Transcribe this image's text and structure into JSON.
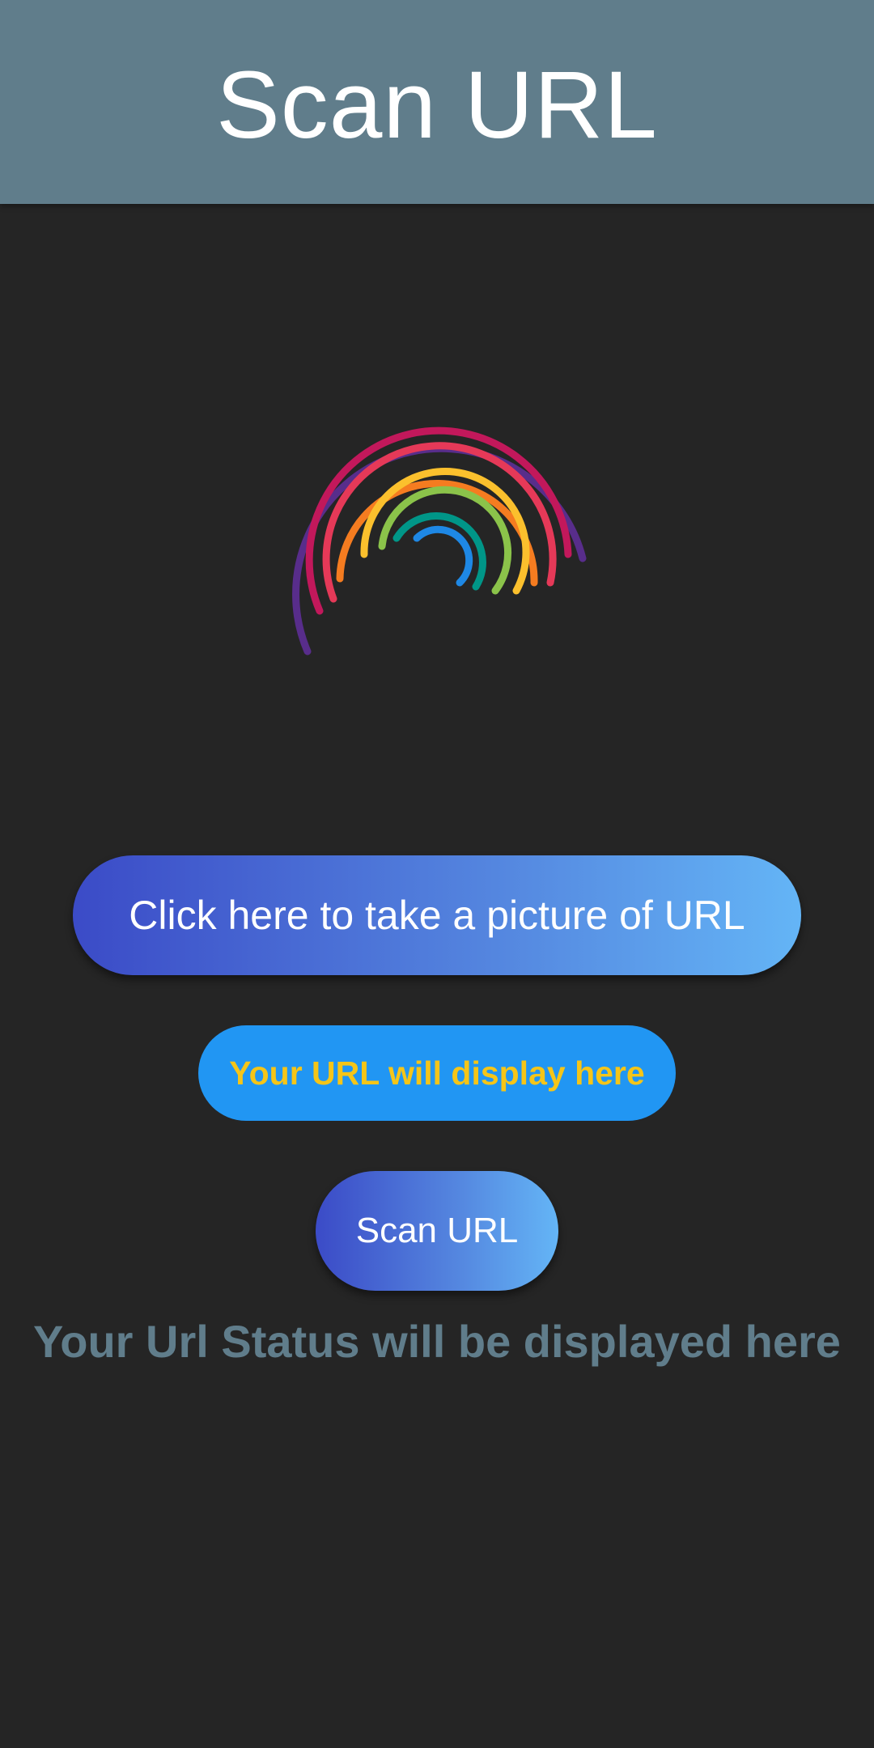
{
  "app_bar": {
    "title": "Scan URL",
    "color": "#607d8b"
  },
  "spinner": {
    "icon": "rainbow-arc-loading-spinner",
    "colors": [
      "#5b2d90",
      "#c2185b",
      "#e91e63",
      "#f57c20",
      "#fbc02d",
      "#8bc34a",
      "#009688",
      "#1e88e5"
    ]
  },
  "buttons": {
    "take_picture_label": "Click here to take a picture of URL",
    "url_display_label": "Your URL will display here",
    "scan_label": "Scan URL"
  },
  "status": {
    "text": "Your Url Status will be displayed here"
  },
  "colors": {
    "background": "#252525",
    "accent_blue": "#2196f3",
    "url_text_yellow": "#f5c518",
    "gradient_start": "#3b4bc7",
    "gradient_end": "#64b5f6"
  }
}
